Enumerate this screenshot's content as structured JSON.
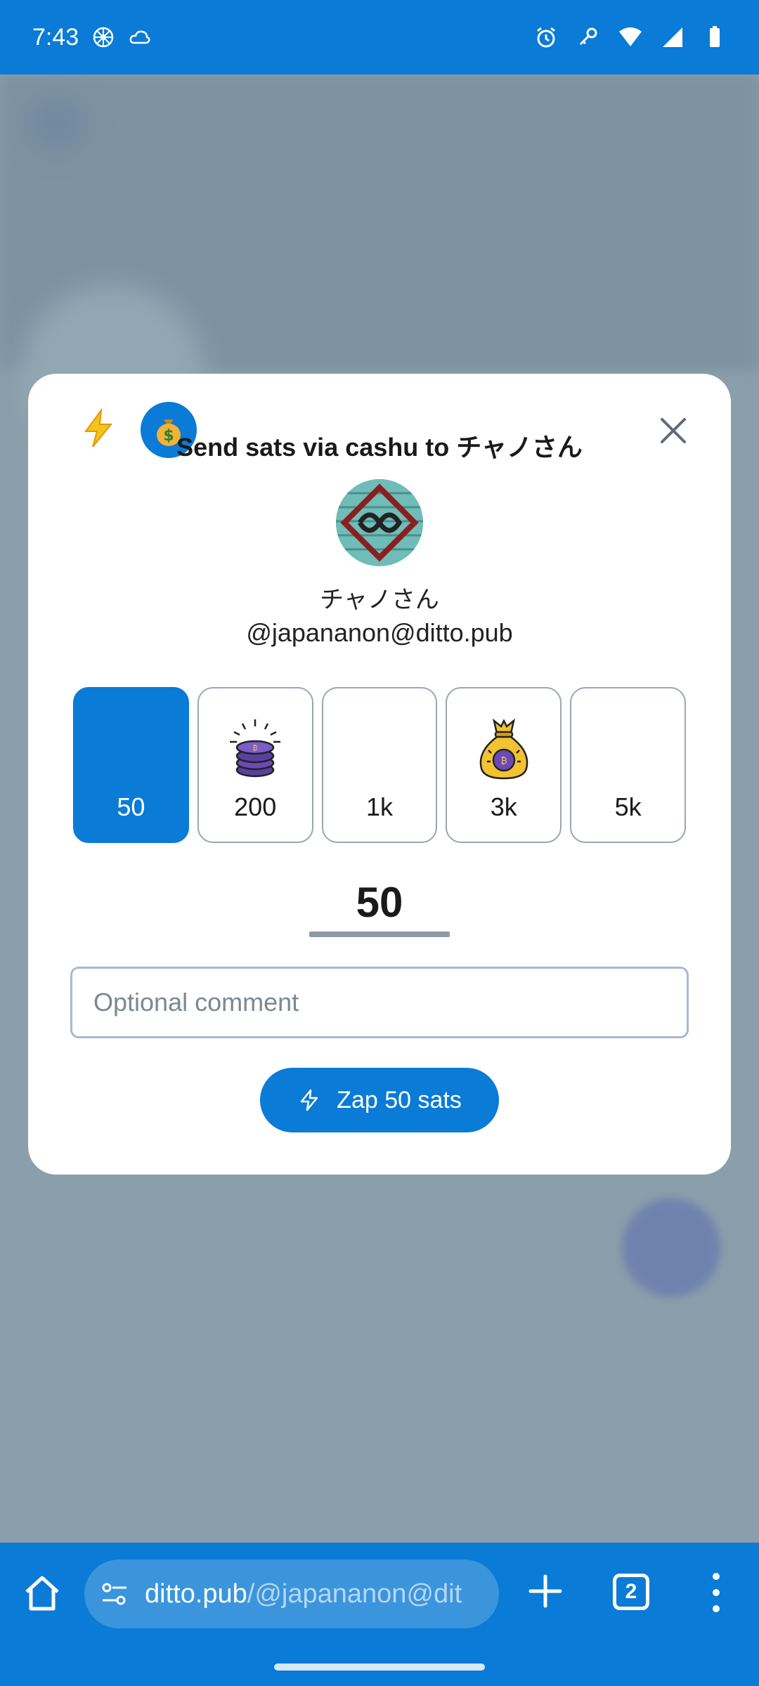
{
  "status_bar": {
    "time": "7:43",
    "left_icons": [
      "flower-icon",
      "cloud-icon"
    ],
    "right_icons": [
      "alarm-icon",
      "key-icon",
      "wifi-icon",
      "signal-icon",
      "battery-icon"
    ]
  },
  "modal": {
    "title": "Send sats via cashu to チャノさん",
    "recipient": {
      "display_name": "チャノさん",
      "handle": "@japananon@ditto.pub"
    },
    "presets": [
      {
        "label": "50",
        "selected": true,
        "art": ""
      },
      {
        "label": "200",
        "selected": false,
        "art": "coin-stack-icon"
      },
      {
        "label": "1k",
        "selected": false,
        "art": ""
      },
      {
        "label": "3k",
        "selected": false,
        "art": "money-bag-icon"
      },
      {
        "label": "5k",
        "selected": false,
        "art": ""
      }
    ],
    "amount": "50",
    "comment_placeholder": "Optional comment",
    "zap_button_label": "Zap 50 sats"
  },
  "browser": {
    "url_host": "ditto.pub",
    "url_path": "/@japananon@dit",
    "tab_count": "2"
  },
  "colors": {
    "accent": "#0a7bd6",
    "status_bar": "#0a7bd6",
    "backdrop": "#8a9aa6"
  }
}
